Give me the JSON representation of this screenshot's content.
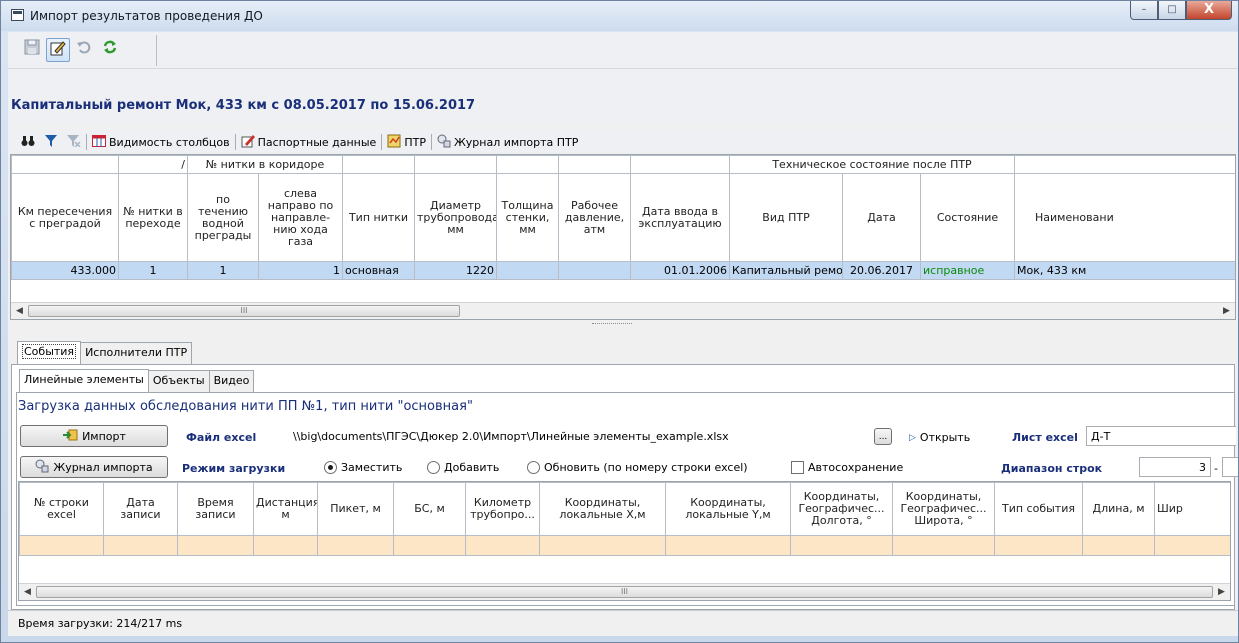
{
  "window": {
    "title": "Импорт результатов проведения ДО",
    "minimize": "–",
    "maximize": "□",
    "close": "X"
  },
  "heading": "Капитальный ремонт Мок, 433 км с 08.05.2017 по 15.06.2017",
  "toolbar2": {
    "columns": "Видимость столбцов",
    "passport": "Паспортные данные",
    "ptr": "ПТР",
    "journal": "Журнал импорта ПТР"
  },
  "grid1": {
    "group_headers": {
      "slash": "/",
      "thread_in_corridor": "№ нитки в коридоре",
      "tech_state": "Техническое состояние после ПТР"
    },
    "columns": {
      "km": "Км пересечения с преградой",
      "thread_no": "№ нитки в переходе",
      "by_flow": "по течению водной преграды",
      "left_right": "слева направо по направле-нию хода газа",
      "thread_type": "Тип нитки",
      "diameter": "Диаметр трубопровода, мм",
      "wall": "Толщина стенки, мм",
      "pressure": "Рабочее давление, атм",
      "date_in": "Дата ввода в эксплуатацию",
      "ptr_kind": "Вид ПТР",
      "date": "Дата",
      "state": "Состояние",
      "name": "Наименовани"
    },
    "row": {
      "km": "433.000",
      "thread_no": "1",
      "by_flow": "1",
      "left_right": "1",
      "thread_type": "основная",
      "diameter": "1220",
      "wall": "",
      "pressure": "",
      "date_in": "01.01.2006",
      "ptr_kind": "Капитальный ремон",
      "date": "20.06.2017",
      "state": "исправное",
      "name": "Мок, 433 км"
    },
    "scroll_grip": "III",
    "state_color": "#0a8a0a"
  },
  "tabs_outer": [
    "События",
    "Исполнители ПТР"
  ],
  "tabs_inner": [
    "Линейные элементы",
    "Объекты",
    "Видео"
  ],
  "subheading": "Загрузка данных обследования нити ПП №1, тип нити \"основная\"",
  "controls": {
    "import_btn": "Импорт",
    "journal_btn": "Журнал импорта",
    "file_label": "Файл excel",
    "file_path": "\\\\big\\documents\\ПГЭС\\Дюкер 2.0\\Импорт\\Линейные элементы_example.xlsx",
    "browse": "...",
    "open": "Открыть",
    "sheet_label": "Лист excel",
    "sheet_value": "Д-Т",
    "mode_label": "Режим загрузки",
    "mode_replace": "Заместить",
    "mode_add": "Добавить",
    "mode_update": "Обновить (по номеру строки excel)",
    "autosave": "Автосохранение",
    "range_label": "Диапазон строк",
    "range_from": "3",
    "range_dash": "-"
  },
  "grid2": {
    "columns": [
      "№ строки excel",
      "Дата записи",
      "Время записи",
      "Дистанция, м",
      "Пикет, м",
      "БС, м",
      "Километр трубопро...",
      "Координаты, локальные X,м",
      "Координаты, локальные Y,м",
      "Координаты, Географичес... Долгота, °",
      "Координаты, Географичес... Широта, °",
      "Тип события",
      "Длина, м",
      "Шир"
    ],
    "scroll_grip": "III"
  },
  "status": "Время загрузки: 214/217 ms",
  "colors": {
    "heading": "#1a2f7a",
    "selected_row": "#c2d9f3",
    "new_row": "#fde6c6"
  }
}
